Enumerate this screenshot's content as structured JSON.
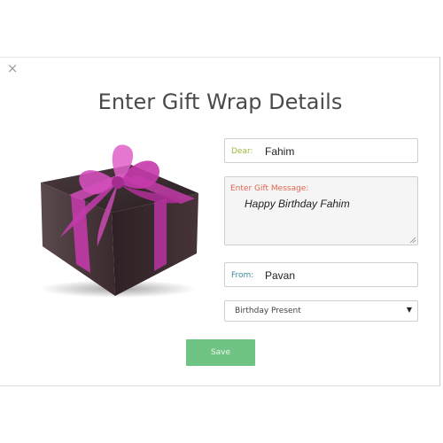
{
  "dialog": {
    "title": "Enter Gift Wrap Details",
    "close_icon": "×"
  },
  "form": {
    "dear": {
      "label": "Dear:",
      "value": "Fahim"
    },
    "message": {
      "label": "Enter Gift Message:",
      "value": "Happy Birthday Fahim"
    },
    "from": {
      "label": "From:",
      "value": "Pavan"
    },
    "occasion": {
      "selected": "Birthday Present",
      "caret": "▼"
    }
  },
  "actions": {
    "save_label": "Save"
  },
  "colors": {
    "dear_label": "#9cba3f",
    "message_label": "#e2654f",
    "from_label": "#3b8a9a",
    "save_button": "#6fc383",
    "ribbon": "#c23ba8",
    "box": "#3b2a2e"
  }
}
